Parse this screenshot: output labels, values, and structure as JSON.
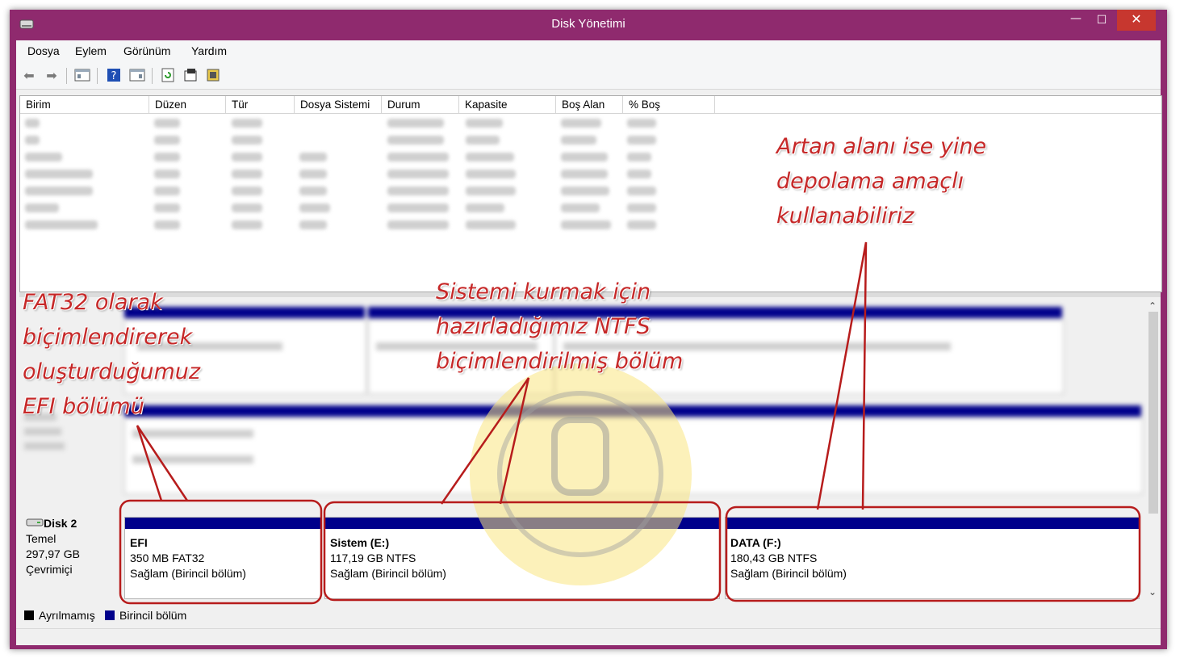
{
  "window": {
    "title": "Disk Yönetimi"
  },
  "menu": [
    "Dosya",
    "Eylem",
    "Görünüm",
    "Yardım"
  ],
  "volume_columns": [
    "Birim",
    "Düzen",
    "Tür",
    "Dosya Sistemi",
    "Durum",
    "Kapasite",
    "Boş Alan",
    "% Boş"
  ],
  "disk2": {
    "name": "Disk 2",
    "type": "Temel",
    "size": "297,97 GB",
    "status": "Çevrimiçi",
    "partitions": [
      {
        "name": "EFI",
        "size_fs": "350 MB FAT32",
        "status": "Sağlam (Birincil bölüm)"
      },
      {
        "name": "Sistem  (E:)",
        "size_fs": "117,19 GB NTFS",
        "status": "Sağlam (Birincil bölüm)"
      },
      {
        "name": "DATA  (F:)",
        "size_fs": "180,43 GB NTFS",
        "status": "Sağlam (Birincil bölüm)"
      }
    ]
  },
  "legend": [
    {
      "label": "Ayrılmamış",
      "color": "#000000"
    },
    {
      "label": "Birincil bölüm",
      "color": "#00008b"
    }
  ],
  "annotations": {
    "efi": [
      "FAT32 olarak",
      "biçimlendirerek",
      "oluşturduğumuz",
      "EFI bölümü"
    ],
    "sistem": [
      "Sistemi kurmak için",
      "hazırladığımız NTFS",
      "biçimlendirilmiş bölüm"
    ],
    "data": [
      "Artan alanı ise yine",
      "depolama amaçlı",
      "kullanabiliriz"
    ]
  },
  "colors": {
    "title_bar": "#8f2a6e",
    "primary_partition": "#00008b",
    "annotation": "#c62828",
    "close_button": "#c7372f"
  }
}
